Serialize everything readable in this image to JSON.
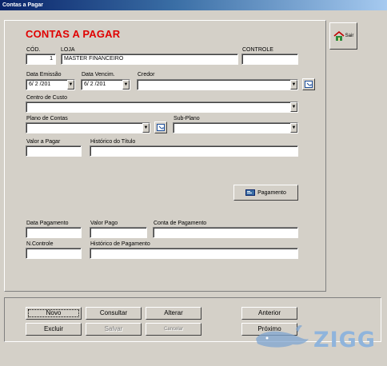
{
  "window": {
    "title": "Contas a Pagar"
  },
  "heading": "CONTAS A PAGAR",
  "sair": {
    "label": "Sair",
    "icon": "exit-house-icon"
  },
  "form": {
    "cod": {
      "label": "CÓD.",
      "value": "1"
    },
    "loja": {
      "label": "LOJA",
      "value": "MASTER FINANCEIRO"
    },
    "controle": {
      "label": "CONTROLE",
      "value": ""
    },
    "data_emissao": {
      "label": "Data Emissão",
      "value": "6/ 2 /201"
    },
    "data_vencim": {
      "label": "Data Vencim.",
      "value": "6/ 2 /201"
    },
    "credor": {
      "label": "Credor",
      "value": ""
    },
    "centro_custo": {
      "label": "Centro de Custo",
      "value": ""
    },
    "plano_contas": {
      "label": "Plano de Contas",
      "value": ""
    },
    "sub_plano": {
      "label": "Sub-Plano",
      "value": ""
    },
    "valor_pagar": {
      "label": "Valor a Pagar",
      "value": ""
    },
    "historico_titulo": {
      "label": "Histórico do Título",
      "value": ""
    },
    "pagamento_button": "Pagamento",
    "data_pagamento": {
      "label": "Data Pagamento",
      "value": ""
    },
    "valor_pago": {
      "label": "Valor Pago",
      "value": ""
    },
    "conta_pagamento": {
      "label": "Conta de Pagamento",
      "value": ""
    },
    "n_controle": {
      "label": "N.Controle",
      "value": ""
    },
    "historico_pagamento": {
      "label": "Histórico de Pagamento",
      "value": ""
    }
  },
  "buttons": {
    "novo": "Novo",
    "consultar": "Consultar",
    "alterar": "Alterar",
    "anterior": "Anterior",
    "excluir": "Excluir",
    "salvar": "Salvar",
    "cancelar": "Cancelar",
    "proximo": "Próximo"
  },
  "watermark": "ZIGG",
  "colors": {
    "heading": "#e00000",
    "face": "#d4d0c8",
    "title_start": "#0a246a"
  }
}
